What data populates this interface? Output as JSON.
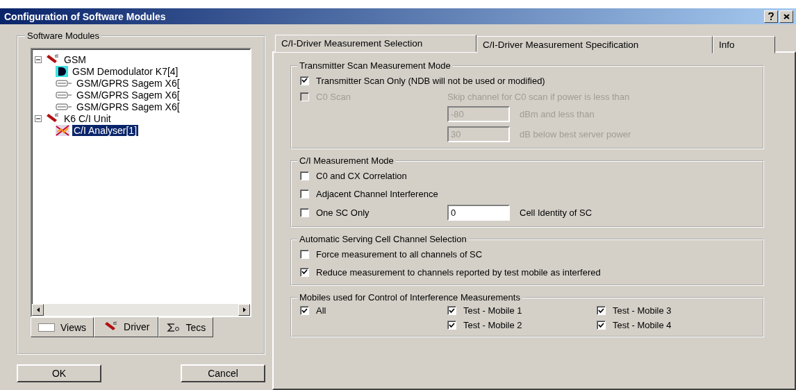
{
  "window": {
    "title": "Configuration of Software Modules"
  },
  "left": {
    "group_title": "Software Modules",
    "tree": [
      {
        "label": "GSM",
        "kind": "driver",
        "expanded": true,
        "selected": false,
        "children": [
          {
            "label": "GSM Demodulator K7[4]",
            "kind": "demod",
            "selected": false
          },
          {
            "label": "GSM/GPRS Sagem X6[",
            "kind": "gprs",
            "selected": false
          },
          {
            "label": "GSM/GPRS Sagem X6[",
            "kind": "gprs",
            "selected": false
          },
          {
            "label": "GSM/GPRS Sagem X6[",
            "kind": "gprs",
            "selected": false
          }
        ]
      },
      {
        "label": "K6 C/I Unit",
        "kind": "driver",
        "expanded": true,
        "selected": false,
        "children": [
          {
            "label": "C/I Analyser[1]",
            "kind": "analyser",
            "selected": true
          }
        ]
      }
    ],
    "tabs": [
      {
        "label": "Views",
        "kind": "views",
        "selected": false
      },
      {
        "label": "Driver",
        "kind": "driver",
        "selected": true
      },
      {
        "label": "Tecs",
        "kind": "tecs",
        "selected": false
      }
    ]
  },
  "buttons": [
    "OK",
    "Cancel"
  ],
  "right": {
    "tabs": [
      {
        "label": "C/I-Driver Measurement Selection",
        "selected": true
      },
      {
        "label": "C/I-Driver Measurement Specification",
        "selected": false
      },
      {
        "label": "Info",
        "selected": false
      }
    ],
    "groups": [
      {
        "title": "Transmitter Scan Measurement Mode",
        "rows": [
          {
            "kind": "check",
            "label": "Transmitter Scan Only  (NDB will not be used or modified)",
            "checked": true,
            "disabled": false
          },
          {
            "kind": "scan",
            "label": "C0 Scan",
            "checked": false,
            "disabled": true,
            "note": "Skip channel for C0 scan if power is less than",
            "fields": [
              {
                "value": "-80",
                "unit": "dBm and less than"
              },
              {
                "value": "30",
                "unit": "dB below best server power"
              }
            ]
          }
        ]
      },
      {
        "title": "C/I Measurement Mode",
        "rows": [
          {
            "kind": "check",
            "label": "C0 and CX Correlation",
            "checked": false,
            "disabled": false
          },
          {
            "kind": "check",
            "label": "Adjacent Channel Interference",
            "checked": false,
            "disabled": false
          },
          {
            "kind": "field",
            "label": "One SC Only",
            "checked": false,
            "disabled": false,
            "value": "0",
            "unit": "Cell Identity of SC"
          }
        ]
      },
      {
        "title": "Automatic Serving Cell Channel Selection",
        "rows": [
          {
            "kind": "check",
            "label": "Force measurement to all channels of SC",
            "checked": false,
            "disabled": false
          },
          {
            "kind": "check",
            "label": "Reduce measurement to channels reported by test mobile as interfered",
            "checked": true,
            "disabled": false
          }
        ]
      },
      {
        "title": "Mobiles used for Control of Interference  Measurements",
        "rows": [
          {
            "kind": "mobiles",
            "all": {
              "label": "All",
              "checked": true
            },
            "items": [
              {
                "label": "Test - Mobile 1",
                "checked": true
              },
              {
                "label": "Test - Mobile 2",
                "checked": true
              },
              {
                "label": "Test - Mobile 3",
                "checked": true
              },
              {
                "label": "Test - Mobile 4",
                "checked": true
              }
            ]
          }
        ]
      }
    ]
  }
}
